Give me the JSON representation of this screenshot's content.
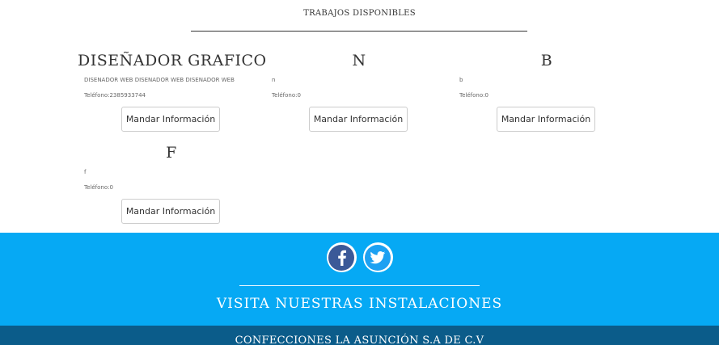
{
  "section": {
    "title": "TRABAJOS DISPONIBLES"
  },
  "jobs": [
    {
      "title": "DISEÑADOR GRAFICO",
      "description": "DISEÑADOR WEB DISEÑADOR WEB DISEÑADOR WEB",
      "phone": "Teléfono:2385933744",
      "button": "Mandar Información"
    },
    {
      "title": "N",
      "description": "n",
      "phone": "Teléfono:0",
      "button": "Mandar Información"
    },
    {
      "title": "B",
      "description": "b",
      "phone": "Teléfono:0",
      "button": "Mandar Información"
    },
    {
      "title": "F",
      "description": "f",
      "phone": "Teléfono:0",
      "button": "Mandar Información"
    }
  ],
  "social": {
    "facebook_icon": "facebook-icon",
    "twitter_icon": "twitter-icon",
    "facebook_color": "#3b5998",
    "twitter_color": "#1da1f2"
  },
  "band": {
    "title": "VISITA NUESTRAS INSTALACIONES",
    "color": "#06a9f4"
  },
  "footer": {
    "text": "CONFECCIONES LA ASUNCIÓN S.A DE C.V",
    "color": "#0b5c8a"
  }
}
